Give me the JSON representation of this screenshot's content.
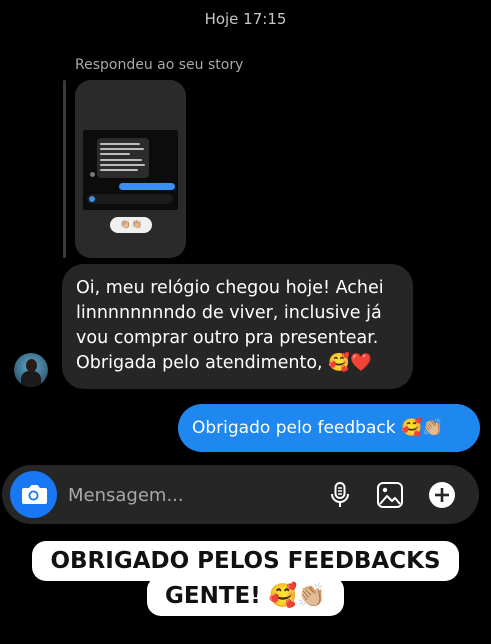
{
  "header": {
    "timestamp": "Hoje 17:15"
  },
  "reply": {
    "label": "Respondeu ao seu story",
    "story_reaction": "👏🏼👏🏼"
  },
  "incoming": {
    "lines": [
      "Oi, meu relógio chegou hoje! Achei",
      "linnnnnnnndo de viver, inclusive já",
      "vou comprar outro pra presentear.",
      "Obrigada pelo atendimento, 🥰❤️"
    ]
  },
  "outgoing": {
    "text": "Obrigado pelo feedback 🥰👏🏼"
  },
  "composer": {
    "placeholder": "Mensagem...",
    "icons": [
      "camera-icon",
      "microphone-icon",
      "gallery-icon",
      "plus-icon"
    ]
  },
  "caption": {
    "line1": "OBRIGADO PELOS FEEDBACKS",
    "line2": "GENTE! 🥰👏🏼"
  },
  "colors": {
    "background": "#000000",
    "incoming_bubble": "#262626",
    "outgoing_bubble": "#1e88f0",
    "camera_button": "#1877f2"
  }
}
